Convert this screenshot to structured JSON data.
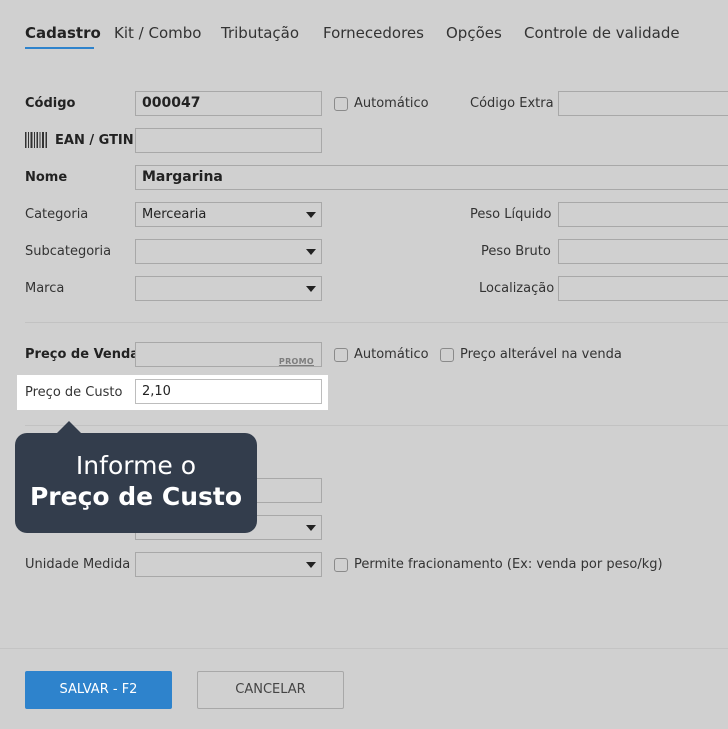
{
  "tabs": [
    {
      "label": "Cadastro",
      "active": true
    },
    {
      "label": "Kit / Combo"
    },
    {
      "label": "Tributação"
    },
    {
      "label": "Fornecedores"
    },
    {
      "label": "Opções"
    },
    {
      "label": "Controle de validade"
    }
  ],
  "form": {
    "codigo": {
      "label": "Código",
      "value": "000047"
    },
    "automatico_label": "Automático",
    "codigo_extra": {
      "label": "Código Extra",
      "value": ""
    },
    "ean": {
      "label": "EAN / GTIN",
      "value": ""
    },
    "nome": {
      "label": "Nome",
      "value": "Margarina"
    },
    "categoria": {
      "label": "Categoria",
      "value": "Mercearia"
    },
    "subcategoria": {
      "label": "Subcategoria",
      "value": ""
    },
    "marca": {
      "label": "Marca",
      "value": ""
    },
    "peso_liquido": {
      "label": "Peso Líquido",
      "value": ""
    },
    "peso_bruto": {
      "label": "Peso Bruto",
      "value": ""
    },
    "localizacao": {
      "label": "Localização",
      "value": ""
    },
    "preco_venda": {
      "label": "Preço de Venda",
      "value": "",
      "promo": "PROMO"
    },
    "automatico_venda_label": "Automático",
    "preco_alteravel_label": "Preço alterável na venda",
    "preco_custo": {
      "label": "Preço de Custo",
      "value": "2,10"
    },
    "unidade_medida": {
      "label": "Unidade Medida",
      "value": ""
    },
    "permite_fracionamento_label": "Permite fracionamento (Ex: venda por peso/kg)"
  },
  "tooltip": {
    "line1": "Informe o",
    "line2": "Preço de Custo"
  },
  "footer": {
    "save_label": "SALVAR - F2",
    "cancel_label": "CANCELAR"
  },
  "colors": {
    "accent": "#2e83cc",
    "tooltip_bg": "#333d4c",
    "overlay": "#d0d0d0"
  }
}
